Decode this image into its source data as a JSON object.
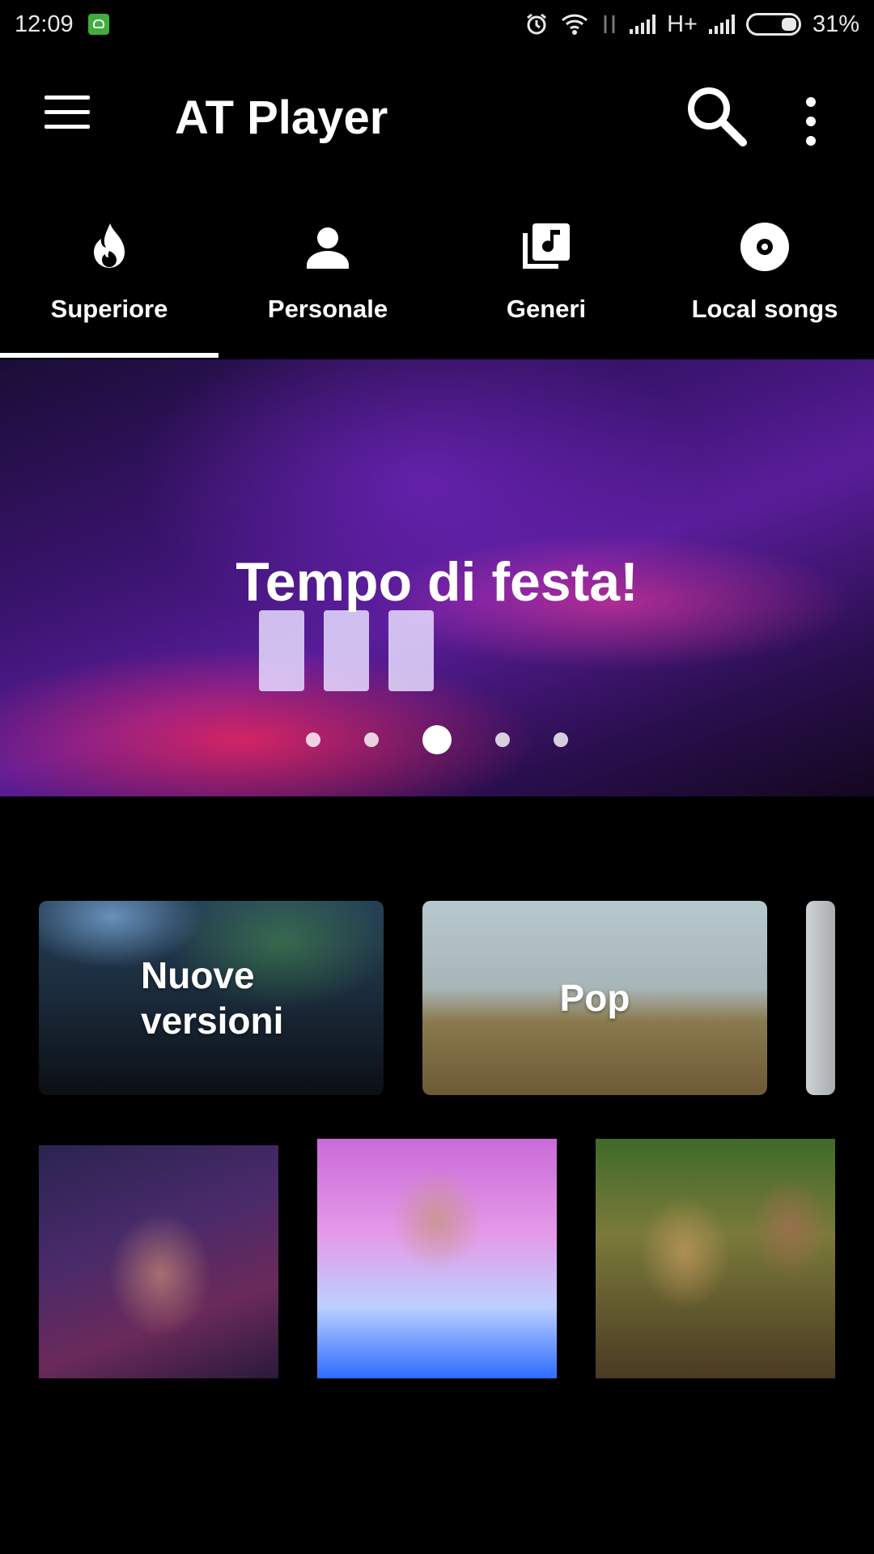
{
  "status_bar": {
    "time": "12:09",
    "network": "H+",
    "battery": "31%"
  },
  "app_bar": {
    "title": "AT Player"
  },
  "tabs": [
    {
      "label": "Superiore",
      "icon": "flame-icon",
      "active": true
    },
    {
      "label": "Personale",
      "icon": "person-icon",
      "active": false
    },
    {
      "label": "Generi",
      "icon": "music-library-icon",
      "active": false
    },
    {
      "label": "Local songs",
      "icon": "disc-icon",
      "active": false
    }
  ],
  "banner": {
    "title": "Tempo di festa!",
    "pager_total": 5,
    "pager_active": 3
  },
  "genres": [
    {
      "label": "Nuove versioni"
    },
    {
      "label": "Pop"
    }
  ],
  "colors": {
    "background": "#000000",
    "text": "#ffffff",
    "accent_indicator": "#ffffff"
  }
}
